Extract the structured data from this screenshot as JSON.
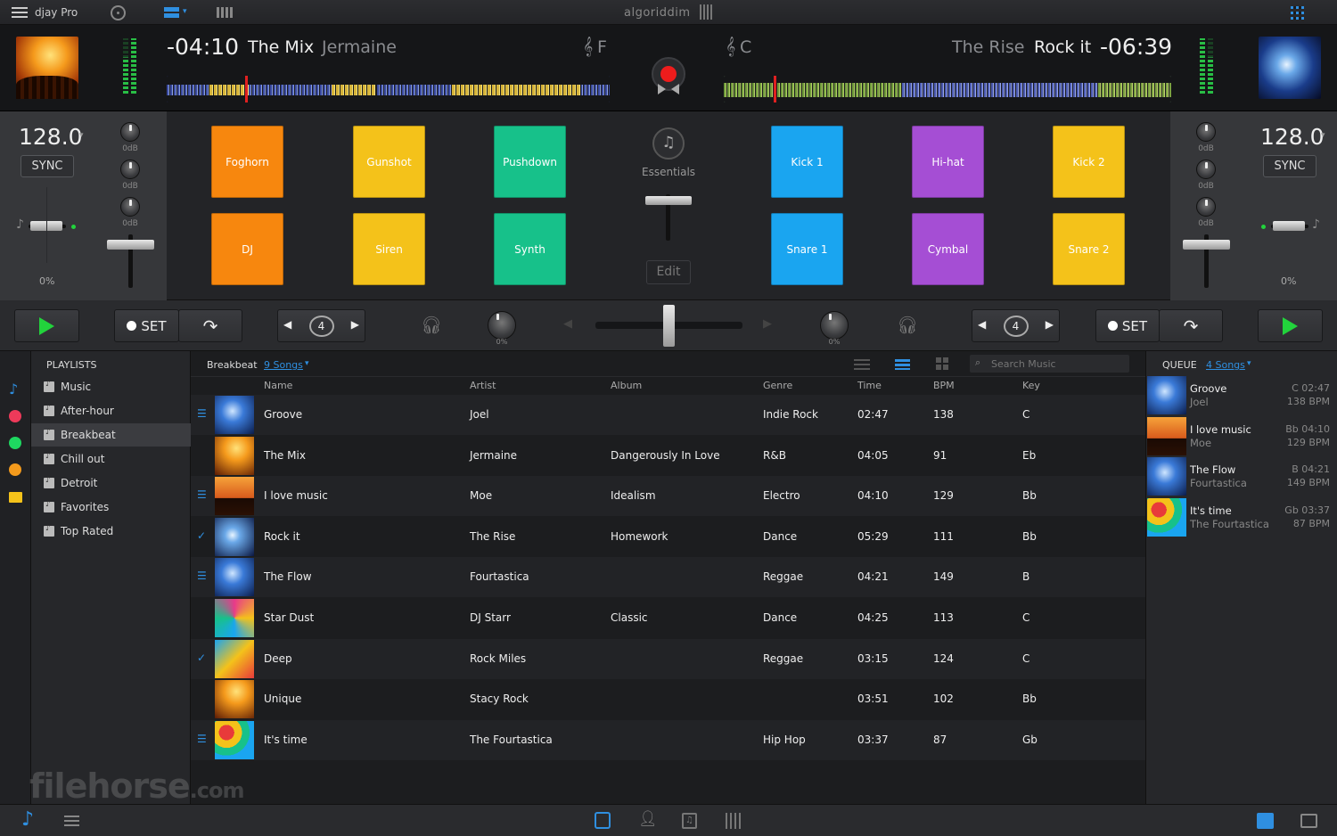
{
  "app": {
    "title": "djay Pro",
    "brand": "algoriddim"
  },
  "deck_left": {
    "time": "-04:10",
    "title": "The Mix",
    "artist": "Jermaine",
    "key": "F",
    "bpm": "128.0",
    "sync_label": "SYNC",
    "pitch": "0%",
    "eq": [
      "0dB",
      "0dB",
      "0dB"
    ],
    "filter": "0%"
  },
  "deck_right": {
    "time": "-06:39",
    "title": "Rock it",
    "artist": "The Rise",
    "key": "C",
    "bpm": "128.0",
    "sync_label": "SYNC",
    "pitch": "0%",
    "eq": [
      "0dB",
      "0dB",
      "0dB"
    ],
    "filter": "0%"
  },
  "sampler": {
    "name": "Essentials",
    "edit_label": "Edit",
    "pads_left": [
      {
        "label": "Foghorn",
        "color": "#f7870e"
      },
      {
        "label": "Gunshot",
        "color": "#f4c21a"
      },
      {
        "label": "Pushdown",
        "color": "#17c18a"
      },
      {
        "label": "DJ",
        "color": "#f7870e"
      },
      {
        "label": "Siren",
        "color": "#f4c21a"
      },
      {
        "label": "Synth",
        "color": "#17c18a"
      }
    ],
    "pads_right": [
      {
        "label": "Kick 1",
        "color": "#1aa5f0"
      },
      {
        "label": "Hi-hat",
        "color": "#a54ed4"
      },
      {
        "label": "Kick 2",
        "color": "#f4c21a"
      },
      {
        "label": "Snare 1",
        "color": "#1aa5f0"
      },
      {
        "label": "Cymbal",
        "color": "#a54ed4"
      },
      {
        "label": "Snare 2",
        "color": "#f4c21a"
      }
    ]
  },
  "transport": {
    "set_label": "SET",
    "loop_left": "4",
    "loop_right": "4"
  },
  "sidebar": {
    "header": "PLAYLISTS",
    "items": [
      "Music",
      "After-hour",
      "Breakbeat",
      "Chill out",
      "Detroit",
      "Favorites",
      "Top Rated"
    ],
    "selected": "Breakbeat"
  },
  "library": {
    "playlist_name": "Breakbeat",
    "count_label": "9 Songs",
    "search_placeholder": "Search Music",
    "columns": [
      "Name",
      "Artist",
      "Album",
      "Genre",
      "Time",
      "BPM",
      "Key"
    ],
    "tracks": [
      {
        "name": "Groove",
        "artist": "Joel",
        "album": "",
        "genre": "Indie Rock",
        "time": "02:47",
        "bpm": "138",
        "key": "C",
        "mark": "queue"
      },
      {
        "name": "The Mix",
        "artist": "Jermaine",
        "album": "Dangerously In Love",
        "genre": "R&B",
        "time": "04:05",
        "bpm": "91",
        "key": "Eb",
        "mark": ""
      },
      {
        "name": "I love music",
        "artist": "Moe",
        "album": "Idealism",
        "genre": "Electro",
        "time": "04:10",
        "bpm": "129",
        "key": "Bb",
        "mark": "queue"
      },
      {
        "name": "Rock it",
        "artist": "The Rise",
        "album": "Homework",
        "genre": "Dance",
        "time": "05:29",
        "bpm": "111",
        "key": "Bb",
        "mark": "played"
      },
      {
        "name": "The Flow",
        "artist": "Fourtastica",
        "album": "",
        "genre": "Reggae",
        "time": "04:21",
        "bpm": "149",
        "key": "B",
        "mark": "queue"
      },
      {
        "name": "Star Dust",
        "artist": "DJ Starr",
        "album": "Classic",
        "genre": "Dance",
        "time": "04:25",
        "bpm": "113",
        "key": "C",
        "mark": ""
      },
      {
        "name": "Deep",
        "artist": "Rock Miles",
        "album": "",
        "genre": "Reggae",
        "time": "03:15",
        "bpm": "124",
        "key": "C",
        "mark": "played"
      },
      {
        "name": "Unique",
        "artist": "Stacy Rock",
        "album": "",
        "genre": "",
        "time": "03:51",
        "bpm": "102",
        "key": "Bb",
        "mark": ""
      },
      {
        "name": "It's time",
        "artist": "The Fourtastica",
        "album": "",
        "genre": "Hip Hop",
        "time": "03:37",
        "bpm": "87",
        "key": "Gb",
        "mark": "queue"
      }
    ]
  },
  "queue": {
    "header": "QUEUE",
    "count_label": "4 Songs",
    "items": [
      {
        "name": "Groove",
        "artist": "Joel",
        "key_time": "C 02:47",
        "bpm": "138 BPM"
      },
      {
        "name": "I love music",
        "artist": "Moe",
        "key_time": "Bb 04:10",
        "bpm": "129 BPM"
      },
      {
        "name": "The Flow",
        "artist": "Fourtastica",
        "key_time": "B 04:21",
        "bpm": "149 BPM"
      },
      {
        "name": "It's time",
        "artist": "The Fourtastica",
        "key_time": "Gb 03:37",
        "bpm": "87 BPM"
      }
    ]
  },
  "watermark": {
    "text": "filehorse",
    "suffix": ".com"
  },
  "colors": {
    "accent": "#2f8fe0",
    "play": "#22d33c",
    "record": "#ee1c1c"
  }
}
